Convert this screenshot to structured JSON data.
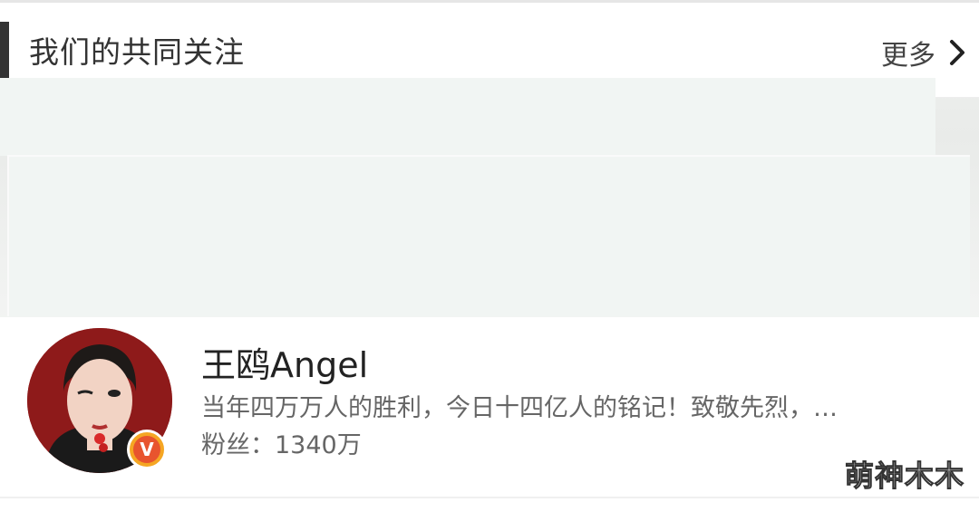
{
  "header": {
    "title": "我们的共同关注",
    "more_label": "更多"
  },
  "user": {
    "name": "王鸥Angel",
    "description": "当年四万万人的胜利，今日十四亿人的铭记！致敬先烈，…",
    "fans": "粉丝：1340万",
    "verified_badge": "V"
  },
  "watermark": "萌神木木",
  "colors": {
    "placeholder": "#f1f5f3",
    "verified_outer": "#f5a623",
    "verified_inner": "#e8542e",
    "avatar_bg": "#8e1a1a"
  },
  "icons": {
    "more": "chevron-right-icon",
    "verified": "verified-badge-icon"
  }
}
